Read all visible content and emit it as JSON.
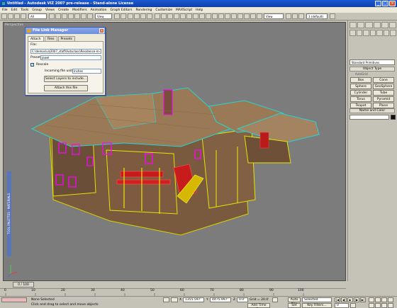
{
  "window": {
    "title": "Untitled - Autodesk VIZ 2007 pre-release - Stand-alone License"
  },
  "menu": [
    "File",
    "Edit",
    "Tools",
    "Group",
    "Views",
    "Create",
    "Modifiers",
    "Animation",
    "Graph Editors",
    "Rendering",
    "Customize",
    "MAXScript",
    "Help"
  ],
  "toolbar": {
    "selection_filter": "All",
    "ref_coord": "View",
    "view_dropdown": "View",
    "render_preset": "3 (default)"
  },
  "viewport": {
    "label": "Perspective",
    "tool_palette_label": "TOOL PALETTES - MATERIALS"
  },
  "dialog": {
    "title": "File Link Manager",
    "tabs": [
      "Attach",
      "Files",
      "Presets"
    ],
    "file_label": "File:",
    "file_path": "C:\\demos\\viz2007_staff\\Autoclass\\Residence-m-3D.d",
    "preset_label": "Preset:",
    "preset_value": "jewel",
    "rescale_label": "Rescale",
    "incoming_units_label": "Incoming file units:",
    "incoming_units_value": "Inches",
    "select_layers_button": "Select Layers to include...",
    "attach_button": "Attach this file"
  },
  "command_panel": {
    "category_dropdown": "Standard Primitives",
    "object_type_header": "Object Type",
    "autogrid_label": "AutoGrid",
    "buttons": [
      "Box",
      "Cone",
      "Sphere",
      "GeoSphere",
      "Cylinder",
      "Tube",
      "Torus",
      "Pyramid",
      "Teapot",
      "Plane"
    ],
    "name_color_header": "Name and Color"
  },
  "timeline": {
    "slider_label": "0 / 100",
    "ticks": [
      "0",
      "10",
      "20",
      "30",
      "40",
      "50",
      "60",
      "70",
      "80",
      "90",
      "100"
    ]
  },
  "status": {
    "selection": "None Selected",
    "prompt": "Click and drag to select and move objects",
    "x_label": "X",
    "x_value": "1355.597'",
    "y_label": "Y",
    "y_value": "4475.997'",
    "z_label": "Z",
    "z_value": "0.0'",
    "grid": "Grid = 20.0'",
    "add_time_tag": "Add Time Tag",
    "auto_key": "Auto Key",
    "set_key": "Set Key",
    "key_mode": "Selected",
    "key_filters": "Key Filters...",
    "frame": "0"
  },
  "colors": {
    "titlebar": "#1c5bd6",
    "viewport_bg": "#7c7c7c",
    "ui_bg": "#c5c2b8"
  }
}
